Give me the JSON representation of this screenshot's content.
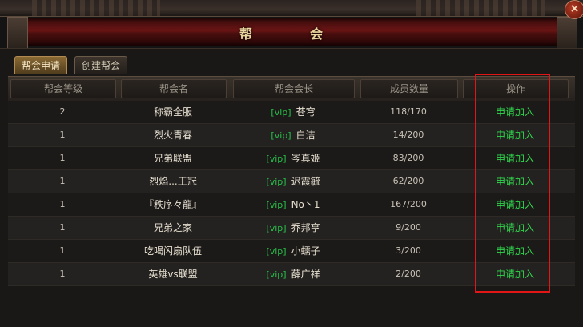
{
  "window": {
    "title": "帮　会",
    "close_label": "×"
  },
  "tabs": [
    {
      "label": "帮会申请",
      "active": true
    },
    {
      "label": "创建帮会",
      "active": false
    }
  ],
  "columns": [
    "帮会等级",
    "帮会名",
    "帮会会长",
    "成员数量",
    "操作"
  ],
  "rows": [
    {
      "level": "2",
      "name": "称霸全服",
      "vip": "[vip]",
      "leader": "苍穹",
      "members": "118/170",
      "action": "申请加入"
    },
    {
      "level": "1",
      "name": "烈火青春",
      "vip": "[vip]",
      "leader": "白洁",
      "members": "14/200",
      "action": "申请加入"
    },
    {
      "level": "1",
      "name": "兄弟联盟",
      "vip": "[vip]",
      "leader": "岑真姬",
      "members": "83/200",
      "action": "申请加入"
    },
    {
      "level": "1",
      "name": "烈焰...王冠",
      "vip": "[vip]",
      "leader": "迟霞毓",
      "members": "62/200",
      "action": "申请加入"
    },
    {
      "level": "1",
      "name": "『秩序々龍』",
      "vip": "[vip]",
      "leader": "No丶1",
      "members": "167/200",
      "action": "申请加入"
    },
    {
      "level": "1",
      "name": "兄弟之家",
      "vip": "[vip]",
      "leader": "乔邦亨",
      "members": "9/200",
      "action": "申请加入"
    },
    {
      "level": "1",
      "name": "吃喝闪扇队伍",
      "vip": "[vip]",
      "leader": "小蠕子",
      "members": "3/200",
      "action": "申请加入"
    },
    {
      "level": "1",
      "name": "英雄vs联盟",
      "vip": "[vip]",
      "leader": "薛广祥",
      "members": "2/200",
      "action": "申请加入"
    }
  ],
  "colors": {
    "highlight_box": "#e21616",
    "vip_green": "#27c24a",
    "apply_green": "#2fd84c"
  }
}
